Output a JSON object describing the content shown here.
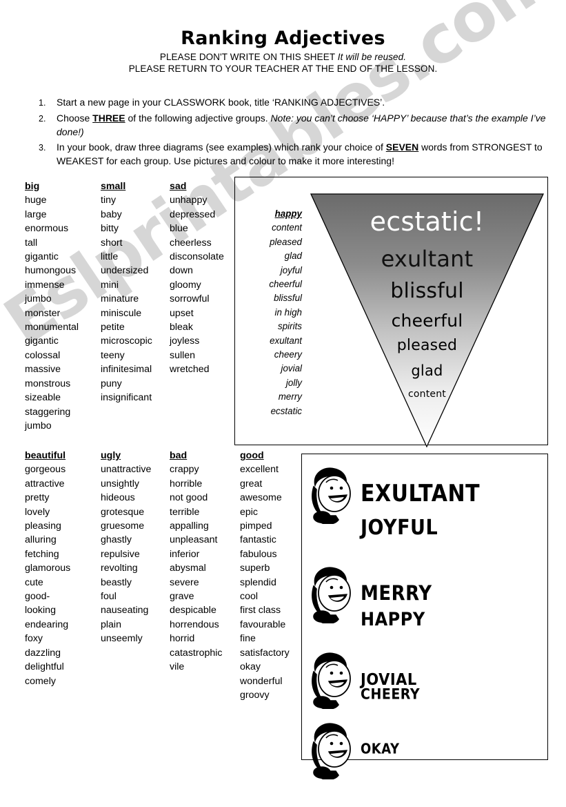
{
  "header": {
    "title": "Ranking Adjectives",
    "notice_line1_plain": "PLEASE DON'T WRITE ON THIS SHEET ",
    "notice_line1_italic": "It will be reused.",
    "notice_line2": "PLEASE RETURN TO YOUR TEACHER AT THE END OF THE LESSON."
  },
  "instructions": [
    {
      "number": "1.",
      "parts": [
        {
          "text": "Start a new page in your CLASSWORK book, title ‘RANKING ADJECTIVES’.",
          "style": "plain"
        }
      ]
    },
    {
      "number": "2.",
      "parts": [
        {
          "text": "Choose ",
          "style": "plain"
        },
        {
          "text": "THREE",
          "style": "underline-bold"
        },
        {
          "text": " of the following adjective groups. ",
          "style": "plain"
        },
        {
          "text": "Note: you can’t choose ‘HAPPY’ because that’s the example I’ve done!)",
          "style": "italic"
        }
      ]
    },
    {
      "number": "3.",
      "parts": [
        {
          "text": "In your book, draw three diagrams (see examples) which rank your choice of ",
          "style": "plain"
        },
        {
          "text": "SEVEN",
          "style": "underline-bold"
        },
        {
          "text": " words from STRONGEST to WEAKEST for each group. Use pictures and colour to make it more interesting!",
          "style": "plain"
        }
      ]
    }
  ],
  "word_groups": {
    "big": {
      "heading": "big",
      "words": [
        "huge",
        "large",
        "enormous",
        "tall",
        "gigantic",
        "humongous",
        "immense",
        "jumbo",
        "monster",
        "monumental",
        "gigantic",
        "colossal",
        "massive",
        "monstrous",
        "sizeable",
        "staggering",
        "jumbo"
      ]
    },
    "small": {
      "heading": "small",
      "words": [
        "tiny",
        "baby",
        "bitty",
        "short",
        "little",
        "undersized",
        "mini",
        "minature",
        "miniscule",
        "petite",
        "microscopic",
        "teeny",
        "infinitesimal",
        "puny",
        "insignificant"
      ]
    },
    "sad": {
      "heading": "sad",
      "words": [
        "unhappy",
        "depressed",
        "blue",
        "cheerless",
        "disconsolate",
        "down",
        "gloomy",
        "sorrowful",
        "upset",
        "bleak",
        "joyless",
        "sullen",
        "wretched"
      ]
    },
    "happy": {
      "heading": "happy",
      "words": [
        "content",
        "pleased",
        "glad",
        "joyful",
        "cheerful",
        "blissful",
        "in high",
        "spirits",
        "exultant",
        "cheery",
        "jovial",
        "jolly",
        "merry",
        "ecstatic"
      ]
    },
    "beautiful": {
      "heading": "beautiful",
      "words": [
        "gorgeous",
        "attractive",
        "pretty",
        "lovely",
        "pleasing",
        "alluring",
        "fetching",
        "glamorous",
        "cute",
        "good-",
        "looking",
        "endearing",
        "foxy",
        "dazzling",
        "delightful",
        "comely"
      ]
    },
    "ugly": {
      "heading": "ugly",
      "words": [
        "unattractive",
        "unsightly",
        "hideous",
        "grotesque",
        "gruesome",
        "ghastly",
        "repulsive",
        "revolting",
        "beastly",
        "foul",
        "nauseating",
        "plain",
        "unseemly"
      ]
    },
    "bad": {
      "heading": "bad",
      "words": [
        "crappy",
        "horrible",
        "not good",
        "terrible",
        "appalling",
        "unpleasant",
        "inferior",
        "abysmal",
        "severe",
        "grave",
        "despicable",
        "horrendous",
        "horrid",
        "catastrophic",
        "vile"
      ]
    },
    "good": {
      "heading": "good",
      "words": [
        "excellent",
        "great",
        "awesome",
        "epic",
        "pimped",
        "fantastic",
        "fabulous",
        "superb",
        "splendid",
        "cool",
        "first class",
        "favourable",
        "fine",
        "satisfactory",
        "okay",
        "wonderful",
        "groovy"
      ]
    }
  },
  "triangle_diagram": {
    "labels": [
      "ecstatic!",
      "exultant",
      "blissful",
      "cheerful",
      "pleased",
      "glad",
      "content"
    ],
    "gradient_top_color": "#6e6e6e",
    "gradient_bottom_color": "#ffffff",
    "outline_color": "#000000"
  },
  "ranked_list": {
    "items": [
      {
        "word": "EXULTANT",
        "face": "cheering-face-icon"
      },
      {
        "word": "JOYFUL",
        "face": null
      },
      {
        "word": "MERRY",
        "face": "laughing-face-icon"
      },
      {
        "word": "HAPPY",
        "face": null
      },
      {
        "word": "JOVIAL",
        "face": "smiling-face-icon"
      },
      {
        "word": "CHEERY",
        "face": null
      },
      {
        "word": "OKAY",
        "face": "content-face-icon"
      }
    ]
  },
  "watermark": {
    "text": "Eslprintables.com"
  }
}
